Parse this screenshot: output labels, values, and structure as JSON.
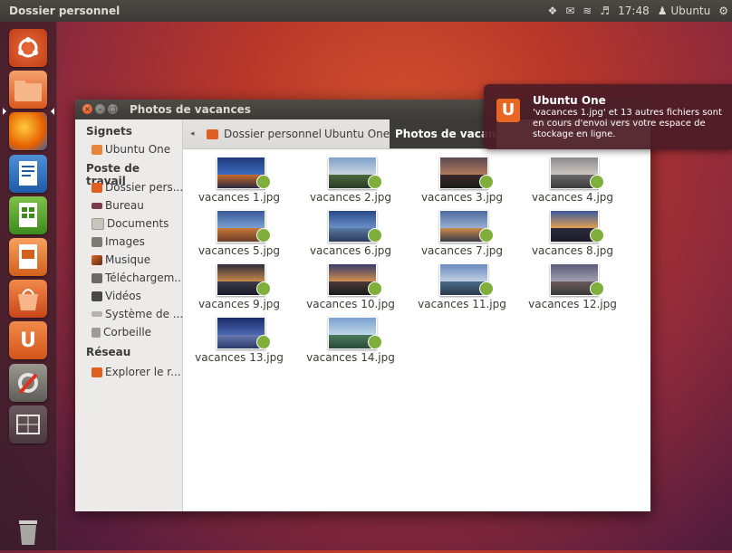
{
  "panel": {
    "app_title": "Dossier personnel",
    "tray": {
      "dropbox_icon": "dropbox-icon",
      "mail_icon": "mail-icon",
      "wifi_icon": "wifi-icon",
      "volume_icon": "volume-icon",
      "time": "17:48",
      "user": "Ubuntu",
      "gear_icon": "gear-icon"
    }
  },
  "launcher": {
    "items": [
      "ubuntu-logo",
      "files",
      "firefox",
      "writer",
      "calc",
      "impress",
      "software-center",
      "ubuntu-one",
      "system-settings",
      "workspace-switcher",
      "trash"
    ]
  },
  "window": {
    "title": "Photos de vacances"
  },
  "sidebar": {
    "sections": [
      {
        "heading": "Signets",
        "items": [
          {
            "label": "Ubuntu One",
            "icon": "folder-icon"
          }
        ]
      },
      {
        "heading": "Poste de travail",
        "items": [
          {
            "label": "Dossier pers...",
            "icon": "home-folder-icon"
          },
          {
            "label": "Bureau",
            "icon": "desktop-icon"
          },
          {
            "label": "Documents",
            "icon": "documents-icon"
          },
          {
            "label": "Images",
            "icon": "images-icon"
          },
          {
            "label": "Musique",
            "icon": "music-icon"
          },
          {
            "label": "Téléchargem...",
            "icon": "downloads-icon"
          },
          {
            "label": "Vidéos",
            "icon": "videos-icon"
          },
          {
            "label": "Système de ...",
            "icon": "filesystem-icon"
          },
          {
            "label": "Corbeille",
            "icon": "trash-icon"
          }
        ]
      },
      {
        "heading": "Réseau",
        "items": [
          {
            "label": "Explorer le r...",
            "icon": "network-icon"
          }
        ]
      }
    ]
  },
  "breadcrumb": {
    "items": [
      "Dossier personnel",
      "Ubuntu One",
      "Photos de vacances"
    ]
  },
  "files": [
    {
      "name": "vacances 1.jpg"
    },
    {
      "name": "vacances 2.jpg"
    },
    {
      "name": "vacances 3.jpg"
    },
    {
      "name": "vacances 4.jpg"
    },
    {
      "name": "vacances 5.jpg"
    },
    {
      "name": "vacances 6.jpg"
    },
    {
      "name": "vacances 7.jpg"
    },
    {
      "name": "vacances 8.jpg"
    },
    {
      "name": "vacances 9.jpg"
    },
    {
      "name": "vacances 10.jpg"
    },
    {
      "name": "vacances 11.jpg"
    },
    {
      "name": "vacances 12.jpg"
    },
    {
      "name": "vacances 13.jpg"
    },
    {
      "name": "vacances 14.jpg"
    }
  ],
  "notification": {
    "title": "Ubuntu One",
    "body": "'vacances 1.jpg' et 13 autres fichiers sont en cours d'envoi vers votre espace de stockage en ligne.",
    "icon": "ubuntu-one-icon"
  },
  "colors": {
    "accent": "#dd4814",
    "panel": "#3c3b37"
  }
}
